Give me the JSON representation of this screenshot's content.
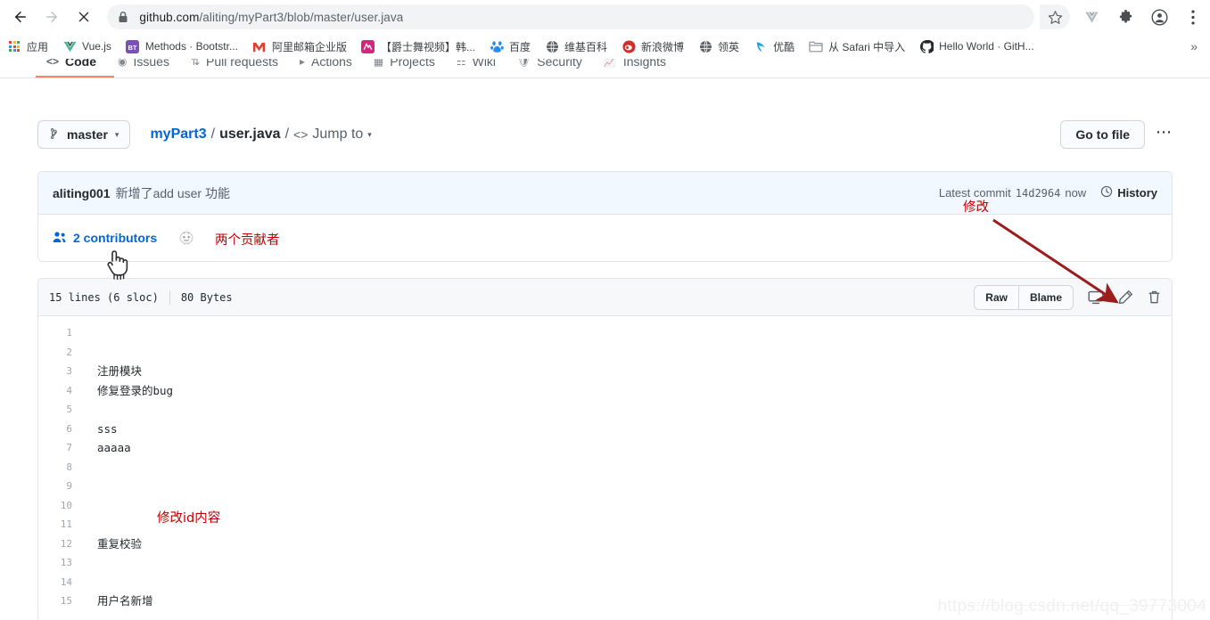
{
  "browser": {
    "nav": {
      "back_icon": "arrow-left-icon",
      "forward_icon": "arrow-right-icon",
      "stop_icon": "close-icon"
    },
    "omnibox": {
      "lock_icon": "lock-icon",
      "host": "github.com",
      "path": "/aliting/myPart3/blob/master/user.java",
      "full_url": "github.com/aliting/myPart3/blob/master/user.java"
    },
    "toolbar_icons": [
      {
        "name": "bookmark-star-icon",
        "glyph": "☆"
      },
      {
        "name": "vue-devtools-icon",
        "glyph": "V"
      },
      {
        "name": "extensions-puzzle-icon",
        "glyph": "❖"
      },
      {
        "name": "profile-avatar-icon",
        "glyph": "●"
      },
      {
        "name": "chrome-menu-icon",
        "glyph": "⋮"
      }
    ],
    "bookmarks": [
      {
        "label": "应用",
        "icon": "apps-grid-icon",
        "color": "#4285f4"
      },
      {
        "label": "Vue.js",
        "icon": "vue-icon",
        "color": "#41b883"
      },
      {
        "label": "Methods · Bootstr...",
        "icon": "bootstrap-icon",
        "color": "#7952b3"
      },
      {
        "label": "阿里邮箱企业版",
        "icon": "mail-icon",
        "color": "#e33e33"
      },
      {
        "label": "【爵士舞视频】韩...",
        "icon": "video-icon",
        "color": "#d6257f"
      },
      {
        "label": "百度",
        "icon": "baidu-icon",
        "color": "#2b8ce6"
      },
      {
        "label": "维基百科",
        "icon": "globe-icon",
        "color": "#5f6368"
      },
      {
        "label": "新浪微博",
        "icon": "weibo-icon",
        "color": "#d52b2b"
      },
      {
        "label": "领英",
        "icon": "globe-icon",
        "color": "#5f6368"
      },
      {
        "label": "优酷",
        "icon": "youku-icon",
        "color": "#1fa3e0"
      },
      {
        "label": "从 Safari 中导入",
        "icon": "folder-icon",
        "color": "#8a8f94"
      },
      {
        "label": "Hello World · GitH...",
        "icon": "github-icon",
        "color": "#24292e"
      }
    ],
    "bookmarks_overflow": "»"
  },
  "github": {
    "nav_tabs": [
      {
        "label": "Code",
        "icon": "code-icon",
        "active": true
      },
      {
        "label": "Issues",
        "icon": "issue-opened-icon",
        "active": false
      },
      {
        "label": "Pull requests",
        "icon": "git-pull-request-icon",
        "active": false
      },
      {
        "label": "Actions",
        "icon": "play-icon",
        "active": false
      },
      {
        "label": "Projects",
        "icon": "project-board-icon",
        "active": false
      },
      {
        "label": "Wiki",
        "icon": "book-icon",
        "active": false
      },
      {
        "label": "Security",
        "icon": "shield-icon",
        "active": false
      },
      {
        "label": "Insights",
        "icon": "graph-icon",
        "active": false
      }
    ],
    "branch": {
      "icon": "git-branch-icon",
      "label": "master",
      "caret": "▾"
    },
    "breadcrumb": {
      "repo": "myPart3",
      "separator": "/",
      "file": "user.java",
      "jump_to": "Jump to",
      "jump_icon": "code-brackets-icon",
      "jump_caret": "▾"
    },
    "go_to_file": "Go to file",
    "kebab_menu": "⋯",
    "commit": {
      "author": "aliting001",
      "message": "新增了add user 功能",
      "latest_label": "Latest commit",
      "sha": "14d2964",
      "time": "now",
      "history_label": "History",
      "history_icon": "history-clock-icon"
    },
    "contributors": {
      "icon": "people-icon",
      "label": "2 contributors",
      "avatar_name": "contributor-avatar"
    },
    "blob": {
      "lines_label": "15 lines (6 sloc)",
      "size_label": "80 Bytes",
      "buttons": [
        "Raw",
        "Blame"
      ],
      "actions": [
        {
          "name": "open-in-desktop-icon",
          "glyph": "desktop"
        },
        {
          "name": "edit-pencil-icon",
          "glyph": "pencil"
        },
        {
          "name": "delete-trash-icon",
          "glyph": "trash"
        }
      ],
      "line_numbers": [
        1,
        2,
        3,
        4,
        5,
        6,
        7,
        8,
        9,
        10,
        11,
        12,
        13,
        14,
        15
      ],
      "lines": [
        "",
        "",
        "注册模块",
        "修复登录的bug",
        "",
        "sss",
        "aaaaa",
        "",
        "",
        "",
        "",
        "重复校验",
        "",
        "",
        "用户名新增"
      ]
    }
  },
  "annotations": {
    "color": "#c00000",
    "contributors_note": "两个贡献者",
    "edit_note": "修改",
    "id_content_note": "修改id内容",
    "cursor_name": "hand-cursor"
  },
  "watermark": "https://blog.csdn.net/qq_39773004",
  "colors": {
    "github_blue": "#0366d6",
    "tab_accent": "#f9826c",
    "commit_bg": "#f1f8ff",
    "border": "#e1e4e8",
    "annotation_red": "#c00000"
  }
}
